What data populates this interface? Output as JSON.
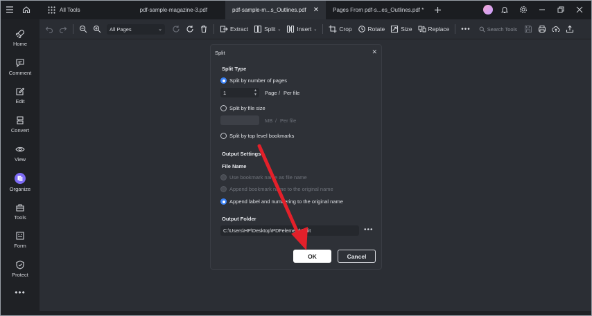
{
  "titlebar": {
    "all_tools": "All Tools",
    "tabs": [
      {
        "label": "pdf-sample-magazine-3.pdf",
        "active": false
      },
      {
        "label": "pdf-sample-m...s_Outlines.pdf",
        "active": true
      },
      {
        "label": "Pages From pdf-s...es_Outlines.pdf *",
        "active": false
      }
    ]
  },
  "sidebar": {
    "items": [
      {
        "label": "Home",
        "icon": "rocket-icon"
      },
      {
        "label": "Comment",
        "icon": "comment-icon"
      },
      {
        "label": "Edit",
        "icon": "edit-icon"
      },
      {
        "label": "Convert",
        "icon": "convert-icon"
      },
      {
        "label": "View",
        "icon": "eye-icon"
      },
      {
        "label": "Organize",
        "icon": "organize-icon"
      },
      {
        "label": "Tools",
        "icon": "toolbox-icon"
      },
      {
        "label": "Form",
        "icon": "form-icon"
      },
      {
        "label": "Protect",
        "icon": "shield-icon"
      }
    ],
    "more": "•••"
  },
  "toolbar": {
    "pages_select": "All Pages",
    "extract": "Extract",
    "split": "Split",
    "insert": "Insert",
    "crop": "Crop",
    "rotate": "Rotate",
    "size": "Size",
    "replace": "Replace",
    "search_placeholder": "Search Tools"
  },
  "dialog": {
    "title": "Split",
    "split_type_heading": "Split Type",
    "option_pages": "Split by number of pages",
    "pages_value": "1",
    "page_unit": "Page",
    "slash": "/",
    "per_file": "Per file",
    "option_size": "Split by file size",
    "size_unit": "MB",
    "option_bookmarks": "Split by top level bookmarks",
    "output_settings_heading": "Output Settings",
    "file_name_heading": "File Name",
    "fn_option_1": "Use bookmark name as file name",
    "fn_option_2": "Append bookmark name to the original name",
    "fn_option_3": "Append label and numbering to the original name",
    "output_folder_heading": "Output Folder",
    "output_folder_value": "C:\\Users\\HP\\Desktop\\PDFelement\\Split",
    "browse": "•••",
    "ok": "OK",
    "cancel": "Cancel"
  },
  "colors": {
    "accent": "#3b82f6",
    "annotation_arrow": "#e3202a",
    "organize_badge": "#7d6bf5"
  }
}
